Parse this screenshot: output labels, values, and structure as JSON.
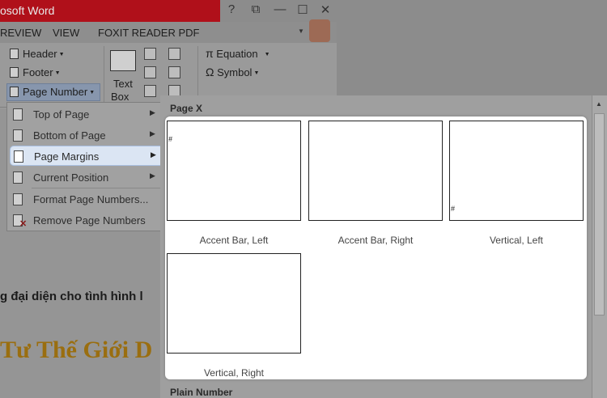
{
  "window": {
    "title": "osoft Word",
    "help_glyph": "?",
    "restore_glyph": "⧉",
    "minimize_glyph": "—",
    "maximize_glyph": "☐",
    "close_glyph": "✕"
  },
  "tabs": [
    "REVIEW",
    "VIEW",
    "FOXIT READER PDF"
  ],
  "ribbon": {
    "header": "Header",
    "footer": "Footer",
    "page_number": "Page Number",
    "text_box_line1": "Text",
    "text_box_line2": "Box",
    "equation_symbol": "π",
    "equation": "Equation",
    "symbol_symbol": "Ω",
    "symbol": "Symbol"
  },
  "page_number_menu": {
    "items": [
      {
        "label": "Top of Page",
        "submenu": true
      },
      {
        "label": "Bottom of Page",
        "submenu": true
      },
      {
        "label": "Page Margins",
        "submenu": true,
        "active": true
      },
      {
        "label": "Current Position",
        "submenu": true
      },
      {
        "label": "Format Page Numbers...",
        "submenu": false
      },
      {
        "label": "Remove Page Numbers",
        "submenu": false
      }
    ]
  },
  "gallery": {
    "section_title": "Page X",
    "items": [
      {
        "caption": "Accent Bar, Left"
      },
      {
        "caption": "Accent Bar, Right"
      },
      {
        "caption": "Vertical, Left"
      },
      {
        "caption": "Vertical, Right"
      }
    ],
    "next_section_title": "Plain Number",
    "page_number_glyph": "#"
  },
  "document": {
    "line_text": "g đại diện cho tình hình l",
    "heading_text": "Tư Thế Giới D"
  },
  "colors": {
    "title_bar": "#b0101a",
    "active_item_bg": "#dbe5f3",
    "heading_gold": "#9a6e10"
  }
}
